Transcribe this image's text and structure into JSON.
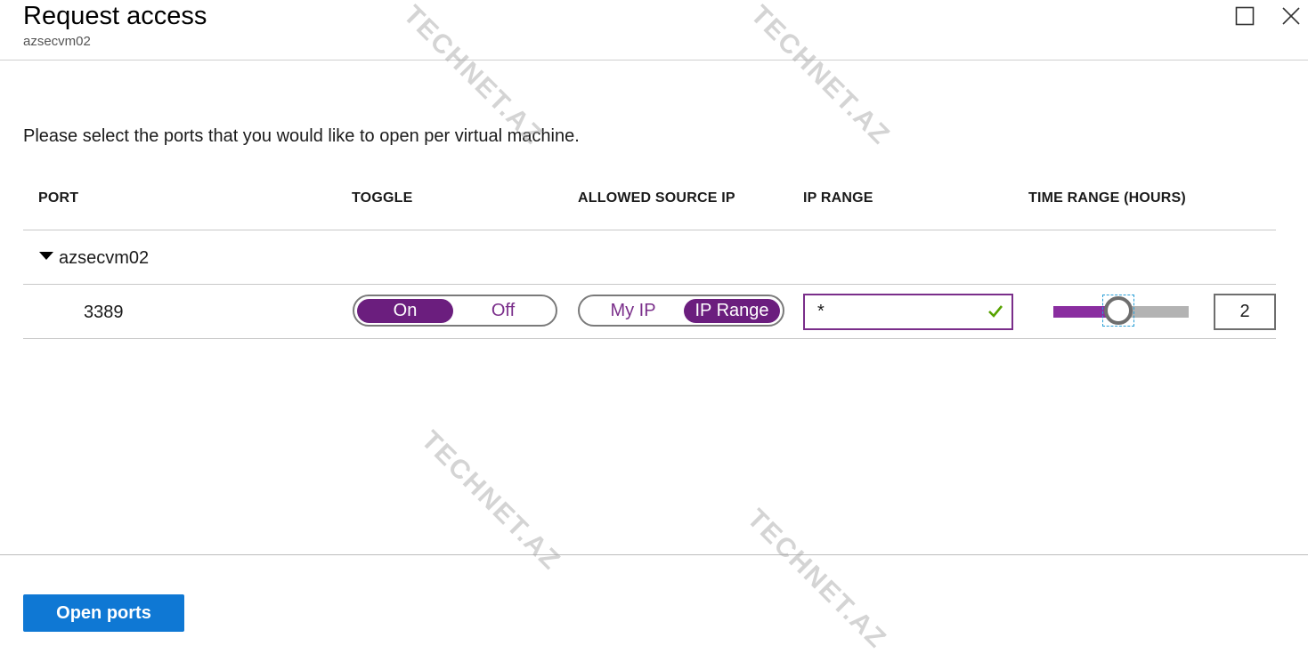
{
  "blade": {
    "title": "Request access",
    "subtitle": "azsecvm02"
  },
  "intro": "Please select the ports that you would like to open per virtual machine.",
  "columns": {
    "port": "PORT",
    "toggle": "TOGGLE",
    "source": "ALLOWED SOURCE IP",
    "range": "IP RANGE",
    "time": "TIME RANGE (HOURS)"
  },
  "group": {
    "label": "azsecvm02",
    "expanded": true
  },
  "row": {
    "port": "3389",
    "toggle": {
      "on": "On",
      "off": "Off",
      "selected": "On"
    },
    "source": {
      "my_ip": "My IP",
      "ip_range": "IP Range",
      "selected": "IP Range"
    },
    "ip_range_value": "*",
    "time_hours": "2",
    "time_slider_fraction": 0.48
  },
  "footer": {
    "open_ports": "Open ports"
  },
  "watermark": "TECHNET.AZ",
  "colors": {
    "accent_purple": "#6b1e7e",
    "primary_blue": "#0f78d4",
    "check_green": "#57a300"
  }
}
